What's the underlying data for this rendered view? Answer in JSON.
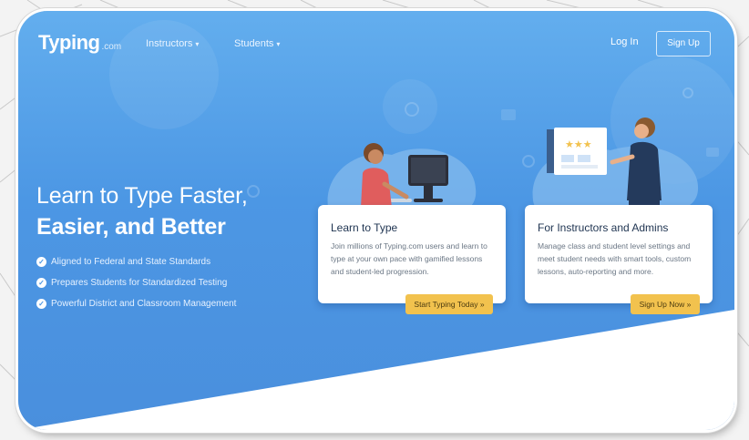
{
  "nav": {
    "logo_main": "Typing",
    "logo_suffix": ".com",
    "instructors": "Instructors",
    "students": "Students",
    "login": "Log In",
    "signup": "Sign Up"
  },
  "hero": {
    "title_line1": "Learn to Type Faster,",
    "title_line2": "Easier, and Better",
    "features": [
      "Aligned to Federal and State Standards",
      "Prepares Students for Standardized Testing",
      "Powerful District and Classroom Management"
    ]
  },
  "cards": [
    {
      "title": "Learn to Type",
      "desc": "Join millions of Typing.com users and learn to type at your own pace with gamified lessons and student-led progression.",
      "button": "Start Typing Today »"
    },
    {
      "title": "For Instructors and Admins",
      "desc": "Manage class and student level settings and meet student needs with smart tools, custom lessons, auto-reporting and more.",
      "button": "Sign Up Now »"
    }
  ],
  "colors": {
    "hero_blue": "#4c97e4",
    "button_yellow": "#f2c24e",
    "card_title": "#1e3350"
  },
  "icons": [
    "check-circle-icon",
    "chevron-down-icon"
  ]
}
